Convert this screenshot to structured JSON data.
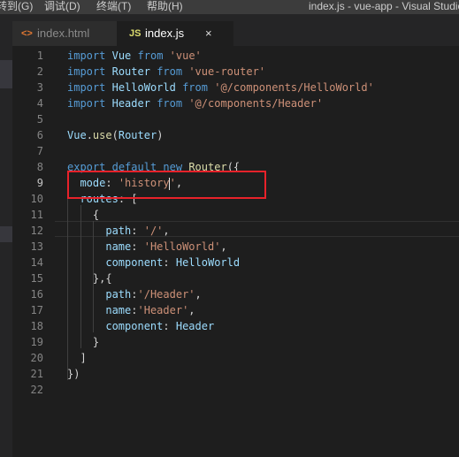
{
  "menu": [
    "转到(G)",
    "调试(D)",
    "终端(T)",
    "帮助(H)"
  ],
  "window_title": "index.js - vue-app - Visual Studio",
  "tabs": [
    {
      "icon": "<>",
      "label": "index.html"
    },
    {
      "icon": "JS",
      "label": "index.js",
      "close": "×"
    }
  ],
  "code_lines": [
    {
      "n": "1",
      "tokens": [
        [
          "kw",
          "import"
        ],
        [
          "pn",
          " "
        ],
        [
          "id",
          "Vue"
        ],
        [
          "pn",
          " "
        ],
        [
          "kw",
          "from"
        ],
        [
          "pn",
          " "
        ],
        [
          "str",
          "'vue'"
        ]
      ]
    },
    {
      "n": "2",
      "tokens": [
        [
          "kw",
          "import"
        ],
        [
          "pn",
          " "
        ],
        [
          "id",
          "Router"
        ],
        [
          "pn",
          " "
        ],
        [
          "kw",
          "from"
        ],
        [
          "pn",
          " "
        ],
        [
          "str",
          "'vue-router'"
        ]
      ]
    },
    {
      "n": "3",
      "tokens": [
        [
          "kw",
          "import"
        ],
        [
          "pn",
          " "
        ],
        [
          "id",
          "HelloWorld"
        ],
        [
          "pn",
          " "
        ],
        [
          "kw",
          "from"
        ],
        [
          "pn",
          " "
        ],
        [
          "str",
          "'@/components/HelloWorld'"
        ]
      ]
    },
    {
      "n": "4",
      "tokens": [
        [
          "kw",
          "import"
        ],
        [
          "pn",
          " "
        ],
        [
          "id",
          "Header"
        ],
        [
          "pn",
          " "
        ],
        [
          "kw",
          "from"
        ],
        [
          "pn",
          " "
        ],
        [
          "str",
          "'@/components/Header'"
        ]
      ]
    },
    {
      "n": "5",
      "tokens": []
    },
    {
      "n": "6",
      "tokens": [
        [
          "id",
          "Vue"
        ],
        [
          "pn",
          "."
        ],
        [
          "fn",
          "use"
        ],
        [
          "pn",
          "("
        ],
        [
          "id",
          "Router"
        ],
        [
          "pn",
          ")"
        ]
      ]
    },
    {
      "n": "7",
      "tokens": []
    },
    {
      "n": "8",
      "tokens": [
        [
          "kw",
          "export"
        ],
        [
          "pn",
          " "
        ],
        [
          "kw",
          "default"
        ],
        [
          "pn",
          " "
        ],
        [
          "kw",
          "new"
        ],
        [
          "pn",
          " "
        ],
        [
          "fn",
          "Router"
        ],
        [
          "pn",
          "({"
        ]
      ]
    },
    {
      "n": "9",
      "tokens": [
        [
          "pn",
          "  "
        ],
        [
          "id",
          "mode"
        ],
        [
          "pn",
          ": "
        ],
        [
          "str",
          "'history"
        ],
        [
          "caret",
          ""
        ],
        [
          "str",
          "'"
        ],
        [
          "pn",
          ","
        ]
      ]
    },
    {
      "n": "10",
      "tokens": [
        [
          "pn",
          "  "
        ],
        [
          "id",
          "routes"
        ],
        [
          "pn",
          ": ["
        ]
      ]
    },
    {
      "n": "11",
      "tokens": [
        [
          "pn",
          "    {"
        ]
      ]
    },
    {
      "n": "12",
      "tokens": [
        [
          "pn",
          "      "
        ],
        [
          "id",
          "path"
        ],
        [
          "pn",
          ": "
        ],
        [
          "str",
          "'/'"
        ],
        [
          "pn",
          ","
        ]
      ]
    },
    {
      "n": "13",
      "tokens": [
        [
          "pn",
          "      "
        ],
        [
          "id",
          "name"
        ],
        [
          "pn",
          ": "
        ],
        [
          "str",
          "'HelloWorld'"
        ],
        [
          "pn",
          ","
        ]
      ]
    },
    {
      "n": "14",
      "tokens": [
        [
          "pn",
          "      "
        ],
        [
          "id",
          "component"
        ],
        [
          "pn",
          ": "
        ],
        [
          "id",
          "HelloWorld"
        ]
      ]
    },
    {
      "n": "15",
      "tokens": [
        [
          "pn",
          "    },{"
        ]
      ]
    },
    {
      "n": "16",
      "tokens": [
        [
          "pn",
          "      "
        ],
        [
          "id",
          "path"
        ],
        [
          "pn",
          ":"
        ],
        [
          "str",
          "'/Header'"
        ],
        [
          "pn",
          ","
        ]
      ]
    },
    {
      "n": "17",
      "tokens": [
        [
          "pn",
          "      "
        ],
        [
          "id",
          "name"
        ],
        [
          "pn",
          ":"
        ],
        [
          "str",
          "'Header'"
        ],
        [
          "pn",
          ","
        ]
      ]
    },
    {
      "n": "18",
      "tokens": [
        [
          "pn",
          "      "
        ],
        [
          "id",
          "component"
        ],
        [
          "pn",
          ": "
        ],
        [
          "id",
          "Header"
        ]
      ]
    },
    {
      "n": "19",
      "tokens": [
        [
          "pn",
          "    }"
        ]
      ]
    },
    {
      "n": "20",
      "tokens": [
        [
          "pn",
          "  ]"
        ]
      ]
    },
    {
      "n": "21",
      "tokens": [
        [
          "pn",
          "})"
        ]
      ]
    },
    {
      "n": "22",
      "tokens": []
    }
  ],
  "current_line": "9",
  "colors": {
    "keyword": "#569cd6",
    "string": "#ce9178",
    "identifier": "#9cdcfe",
    "function": "#dcdcaa",
    "annotation_box": "#e8222a"
  }
}
